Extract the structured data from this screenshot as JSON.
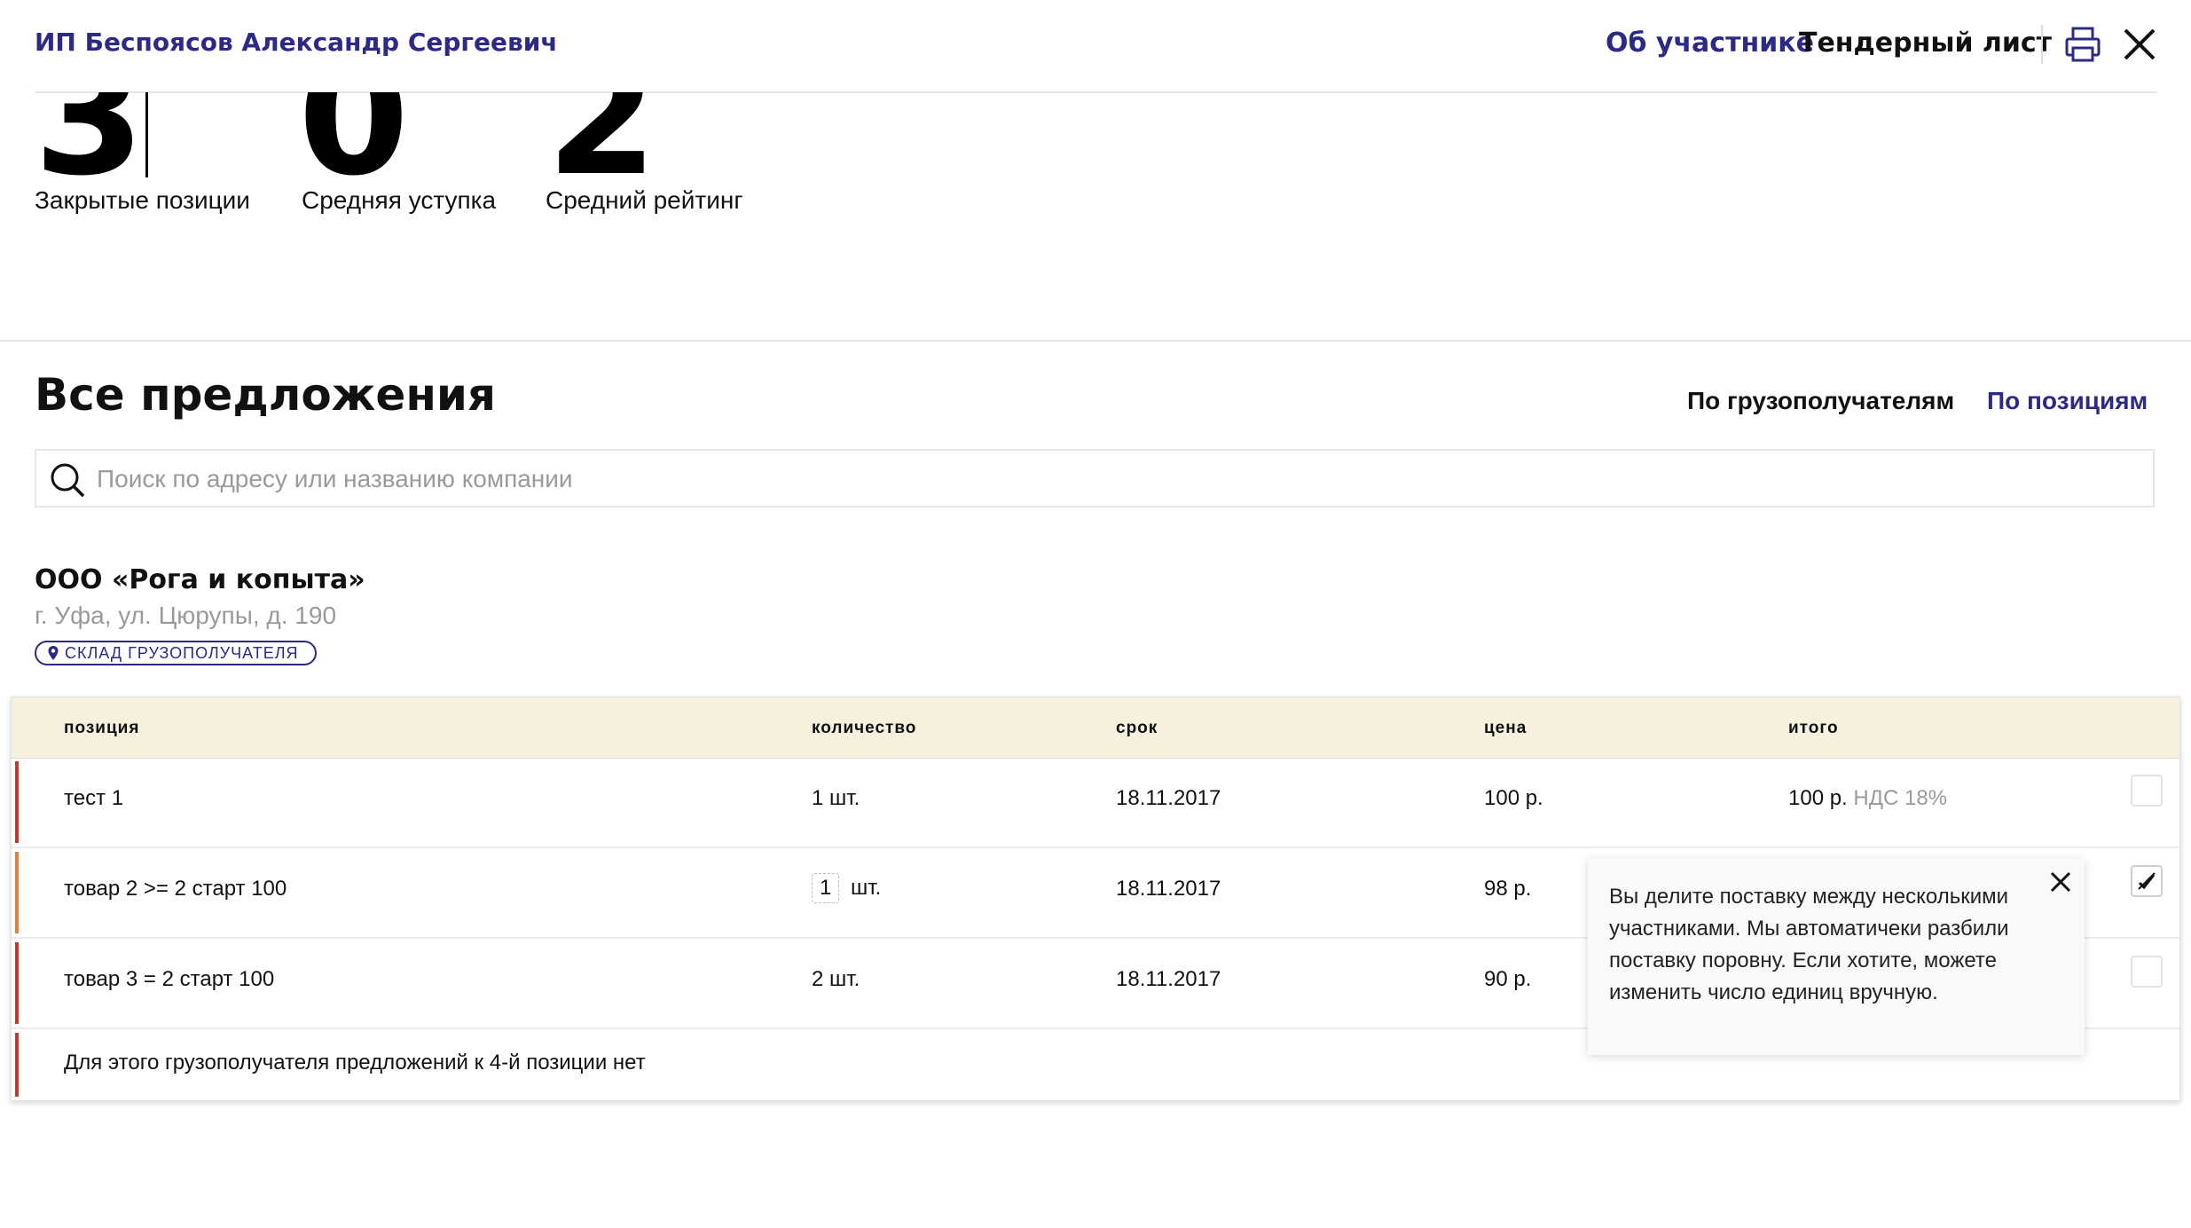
{
  "header": {
    "company_name": "ИП Беспоясов Александр Сергеевич",
    "links": {
      "about": "Об участнике",
      "tender_sheet": "Тендерный лист"
    },
    "icons": [
      "print-icon",
      "close-icon"
    ],
    "brand_color": "#2d2a86"
  },
  "stats": [
    {
      "value": "3",
      "label": "Закрытые позиции"
    },
    {
      "value": "0",
      "label": "Средняя уступка"
    },
    {
      "value": "2",
      "label": "Средний рейтинг"
    }
  ],
  "offers": {
    "title": "Все предложения",
    "view_toggle": {
      "by_consignee": "По грузополучателям",
      "by_position": "По позициям",
      "active": "by_consignee"
    },
    "search": {
      "placeholder": "Поиск по адресу или названию компании",
      "value": ""
    },
    "consignee": {
      "name": "ООО «Рога и копыта»",
      "address": "г. Уфа, ул. Цюрупы, д. 190",
      "badge": "СКЛАД ГРУЗОПОЛУЧАТЕЛЯ"
    },
    "table": {
      "columns": [
        "позиция",
        "количество",
        "срок",
        "цена",
        "итого"
      ],
      "rows": [
        {
          "position": "тест 1",
          "qty": "1 шт.",
          "qty_value": "",
          "qty_unit": "",
          "term": "18.11.2017",
          "price": "100 р.",
          "total": "100 р.",
          "vat": "НДС 18%",
          "checked": false,
          "bar_color": "#c0392b"
        },
        {
          "position": "товар 2 >= 2 старт 100",
          "qty": "",
          "qty_value": "1",
          "qty_unit": "шт.",
          "term": "18.11.2017",
          "price": "98 р.",
          "total": "",
          "vat": "",
          "checked": true,
          "bar_color": "#e67e3c"
        },
        {
          "position": "товар 3 = 2 старт 100",
          "qty": "2 шт.",
          "qty_value": "",
          "qty_unit": "",
          "term": "18.11.2017",
          "price": "90 р.",
          "total": "",
          "vat": "",
          "checked": false,
          "bar_color": "#c0392b"
        }
      ],
      "no_offers_note": "Для этого грузополучателя предложений к 4-й позиции нет",
      "note_bar_color": "#c0392b"
    },
    "tooltip": {
      "text": "Вы делите поставку между несколькими участниками. Мы автоматичеки разбили поставку поровну. Если хотите, можете изменить число единиц вручную."
    }
  }
}
